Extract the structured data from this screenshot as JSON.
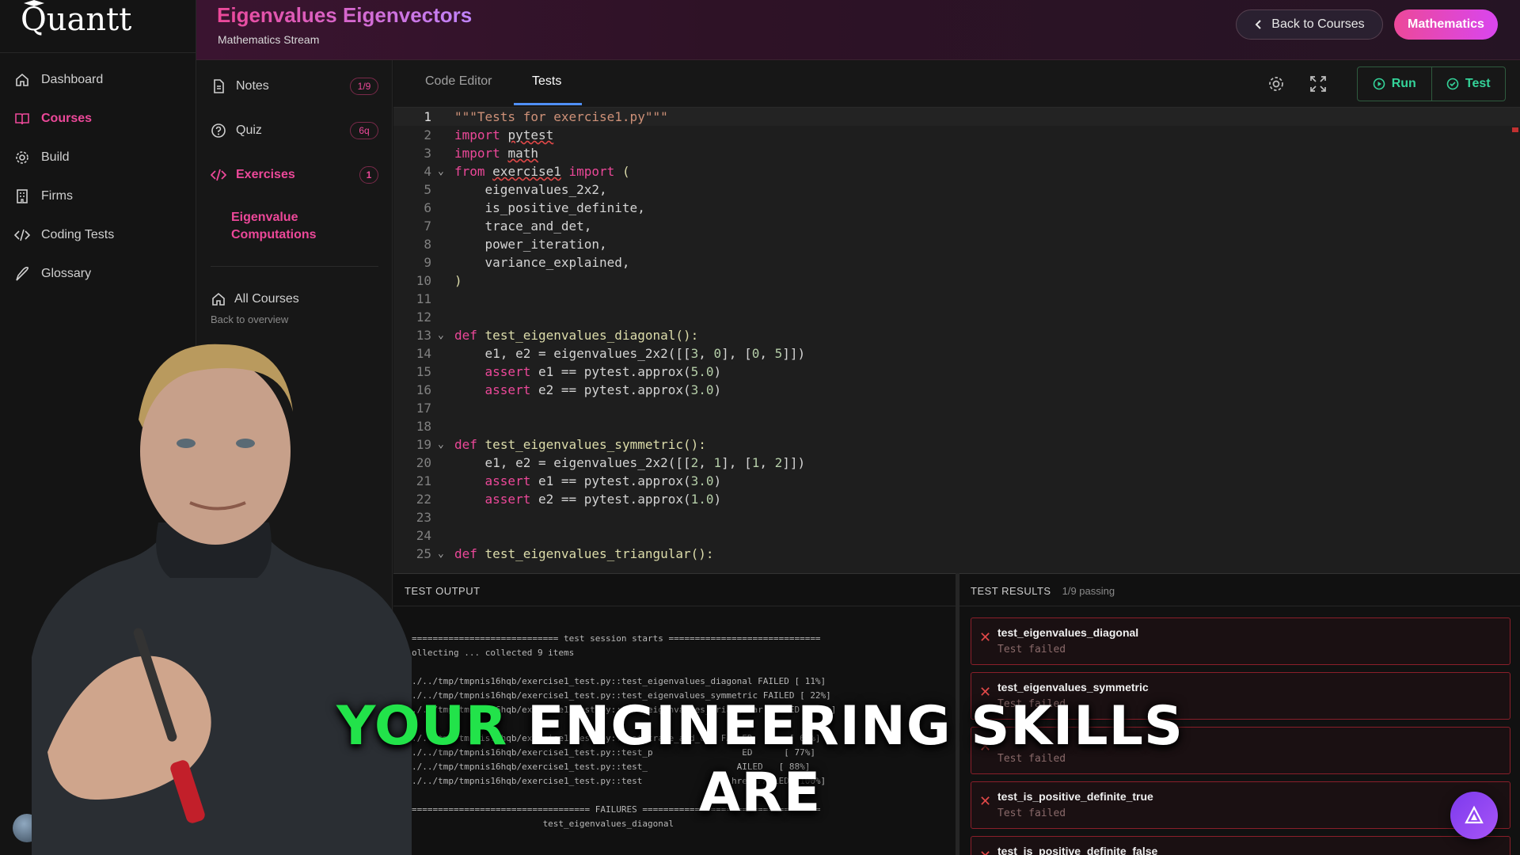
{
  "app": {
    "logo": "Quantt"
  },
  "header": {
    "title": "Eigenvalues Eigenvectors",
    "subtitle": "Mathematics Stream",
    "back_label": "Back to Courses",
    "badge_label": "Mathematics"
  },
  "nav": {
    "items": [
      {
        "label": "Dashboard",
        "icon": "home-icon",
        "active": false
      },
      {
        "label": "Courses",
        "icon": "book-icon",
        "active": true
      },
      {
        "label": "Build",
        "icon": "gear-icon",
        "active": false
      },
      {
        "label": "Firms",
        "icon": "building-icon",
        "active": false
      },
      {
        "label": "Coding Tests",
        "icon": "code-icon",
        "active": false
      },
      {
        "label": "Glossary",
        "icon": "feather-icon",
        "active": false
      }
    ]
  },
  "course_sidebar": {
    "notes": {
      "label": "Notes",
      "badge": "1/9"
    },
    "quiz": {
      "label": "Quiz",
      "badge": "6q"
    },
    "exercises": {
      "label": "Exercises",
      "badge": "1"
    },
    "exercise_item": "Eigenvalue Computations",
    "all_courses": {
      "label": "All Courses",
      "sub": "Back to overview"
    }
  },
  "editor": {
    "tabs": [
      {
        "label": "Code Editor",
        "active": false
      },
      {
        "label": "Tests",
        "active": true
      }
    ],
    "run_label": "Run",
    "test_label": "Test",
    "accent": "#4f8ff7",
    "run_color": "#34d399"
  },
  "test_output": {
    "heading": "TEST OUTPUT",
    "lines": [
      "============================ test session starts =============================",
      "ollecting ... collected 9 items",
      "",
      "./../tmp/tmpnis16hqb/exercise1_test.py::test_eigenvalues_diagonal FAILED [ 11%]",
      "./../tmp/tmpnis16hqb/exercise1_test.py::test_eigenvalues_symmetric FAILED [ 22%]",
      "./../tmp/tmpnis16hqb/exercise1_test.py::test_eigenvalues_triangular FAILED [ 33%]",
      "./../tmp/tmpnis16hqb/exercise1_test.py::test_trace_and_det FAILED       [ 66%]",
      "./../tmp/tmpnis16hqb/exercise1_test.py::test_p                 ED      [ 77%]",
      "./../tmp/tmpnis16hqb/exercise1_test.py::test_                 AILED   [ 88%]",
      "./../tmp/tmpnis16hqb/exercise1_test.py::test                 hree FAILED [100%]",
      "",
      "================================== FAILURES ==================================",
      "                         test_eigenvalues_diagonal"
    ]
  },
  "test_results": {
    "heading": "TEST RESULTS",
    "summary": "1/9 passing",
    "items": [
      {
        "name": "test_eigenvalues_diagonal",
        "status": "Test failed"
      },
      {
        "name": "test_eigenvalues_symmetric",
        "status": "Test failed"
      },
      {
        "name": "",
        "status": "Test failed"
      },
      {
        "name": "test_is_positive_definite_true",
        "status": "Test failed"
      },
      {
        "name": "test_is_positive_definite_false",
        "status": ""
      }
    ],
    "fail_color": "#e04848"
  },
  "caption": {
    "word1": "YOUR",
    "word2": "ENGINEERING SKILLS",
    "line2": "ARE"
  }
}
